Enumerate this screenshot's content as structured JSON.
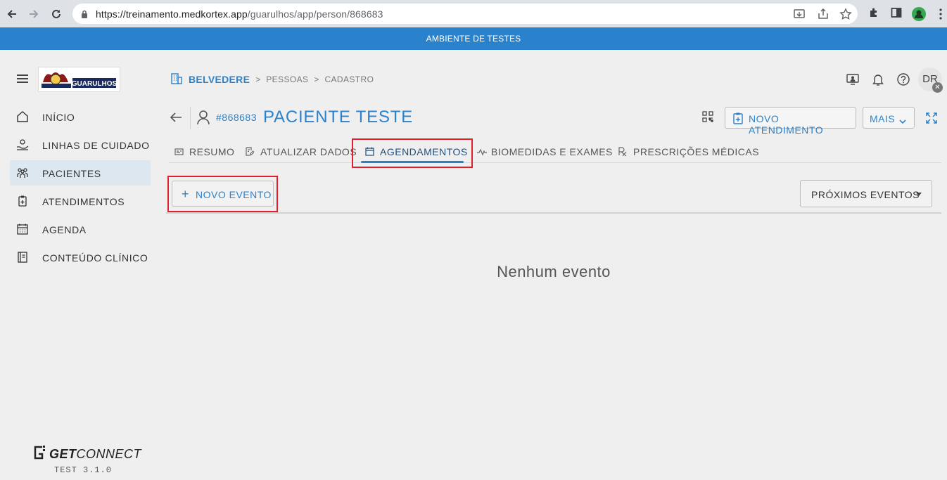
{
  "browser": {
    "url_host": "https://treinamento.medkortex.app",
    "url_path": "/guarulhos/app/person/868683"
  },
  "env_banner": "AMBIENTE DE TESTES",
  "sidebar": {
    "logo_text": "GUARULHOS",
    "items": [
      {
        "label": "INÍCIO",
        "icon": "home-icon",
        "active": false
      },
      {
        "label": "LINHAS DE CUIDADO",
        "icon": "care-hand-icon",
        "active": false
      },
      {
        "label": "PACIENTES",
        "icon": "patients-icon",
        "active": true
      },
      {
        "label": "ATENDIMENTOS",
        "icon": "clipboard-icon",
        "active": false
      },
      {
        "label": "AGENDA",
        "icon": "calendar-icon",
        "active": false
      },
      {
        "label": "CONTEÚDO CLÍNICO",
        "icon": "book-icon",
        "active": false
      }
    ],
    "brand_bold": "GET",
    "brand_rest": "CONNECT",
    "version": "TEST 3.1.0"
  },
  "breadcrumb": {
    "root": "BELVEDERE",
    "items": [
      "PESSOAS",
      "CADASTRO"
    ]
  },
  "user": {
    "initials": "DR"
  },
  "patient": {
    "id": "#868683",
    "name": "PACIENTE TESTE"
  },
  "actions": {
    "novo_atendimento": "NOVO ATENDIMENTO",
    "mais": "MAIS"
  },
  "tabs": [
    {
      "label": "RESUMO",
      "icon": "summary-icon"
    },
    {
      "label": "ATUALIZAR DADOS",
      "icon": "edit-doc-icon"
    },
    {
      "label": "AGENDAMENTOS",
      "icon": "calendar-icon",
      "active": true
    },
    {
      "label": "BIOMEDIDAS E EXAMES",
      "icon": "pulse-icon"
    },
    {
      "label": "PRESCRIÇÕES MÉDICAS",
      "icon": "rx-icon"
    }
  ],
  "events": {
    "new_event_label": "NOVO EVENTO",
    "filter_label": "PRÓXIMOS EVENTOS",
    "empty_message": "Nenhum evento"
  },
  "colors": {
    "primary": "#2b82cc",
    "highlight": "#e0202a",
    "active_menu_bg": "#dde7f0"
  }
}
